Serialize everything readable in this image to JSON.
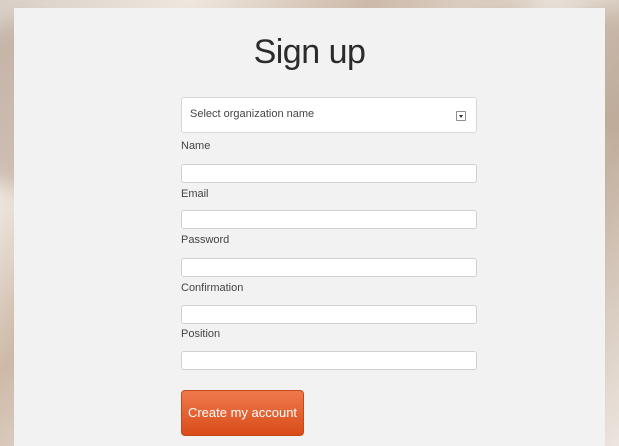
{
  "page": {
    "title": "Sign up"
  },
  "form": {
    "organization_select": {
      "selected_value": "Select organization name"
    },
    "fields": [
      {
        "label": "Name",
        "value": ""
      },
      {
        "label": "Email",
        "value": ""
      },
      {
        "label": "Password",
        "value": ""
      },
      {
        "label": "Confirmation",
        "value": ""
      },
      {
        "label": "Position",
        "value": ""
      }
    ],
    "submit_label": "Create my account"
  },
  "colors": {
    "button_top": "#ef7a4d",
    "button_bottom": "#d94b19",
    "panel_bg": "#f2f2f2"
  }
}
